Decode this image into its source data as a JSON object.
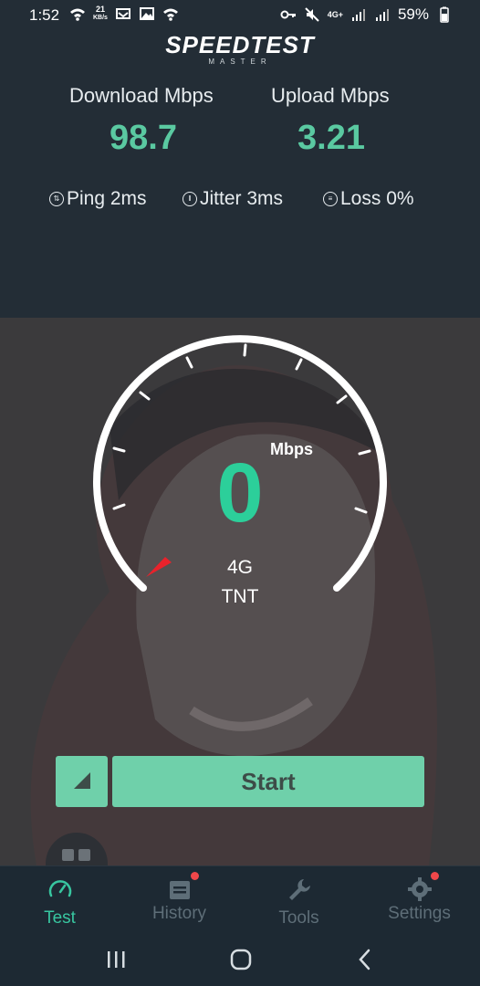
{
  "status_bar": {
    "time": "1:52",
    "net_speed_value": "21",
    "net_speed_unit": "KB/s",
    "network_label": "4G+",
    "battery": "59%"
  },
  "header": {
    "logo_text": "SPEEDTEST",
    "logo_sub": "MASTER",
    "download_label": "Download Mbps",
    "download_value": "98.7",
    "upload_label": "Upload Mbps",
    "upload_value": "3.21",
    "ping": "Ping 2ms",
    "jitter": "Jitter 3ms",
    "loss": "Loss 0%"
  },
  "gauge": {
    "value": "0",
    "unit": "Mbps",
    "network_type": "4G",
    "carrier": "TNT"
  },
  "actions": {
    "start_label": "Start"
  },
  "tabs": [
    {
      "label": "Test",
      "icon": "speedometer-icon",
      "active": true
    },
    {
      "label": "History",
      "icon": "calendar-icon",
      "badge": true
    },
    {
      "label": "Tools",
      "icon": "wrench-icon"
    },
    {
      "label": "Settings",
      "icon": "gear-icon",
      "badge": true
    }
  ],
  "colors": {
    "accent": "#2ccf9a",
    "button": "#6fd0aa",
    "header_bg": "#232d36",
    "badge": "#f0474a"
  }
}
